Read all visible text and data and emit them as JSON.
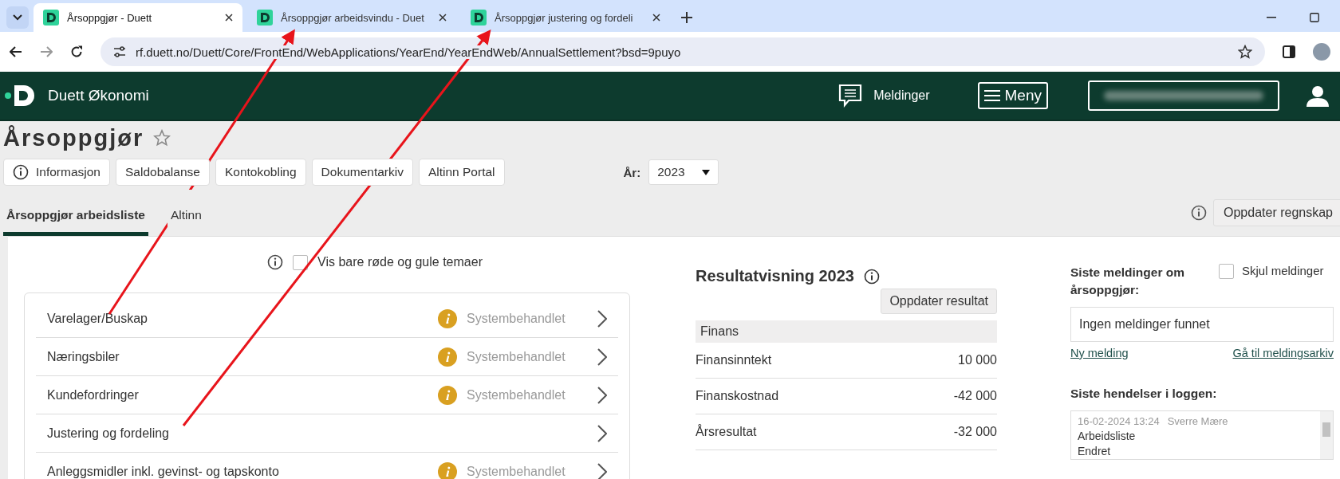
{
  "browser": {
    "tabs": [
      {
        "title": "Årsoppgjør - Duett",
        "selected": true
      },
      {
        "title": "Årsoppgjør arbeidsvindu - Duet",
        "selected": false
      },
      {
        "title": "Årsoppgjør justering og fordeli",
        "selected": false
      }
    ],
    "url": "rf.duett.no/Duett/Core/FrontEnd/WebApplications/YearEnd/YearEndWeb/AnnualSettlement?bsd=9puyo"
  },
  "header": {
    "brand": "Duett Økonomi",
    "messages": "Meldinger",
    "menu": "Meny"
  },
  "page": {
    "title": "Årsoppgjør",
    "toolbar": [
      {
        "label": "Informasjon",
        "kind": "info"
      },
      {
        "label": "Saldobalanse",
        "kind": "plain"
      },
      {
        "label": "Kontokobling",
        "kind": "plain"
      },
      {
        "label": "Dokumentarkiv",
        "kind": "plain"
      },
      {
        "label": "Altinn Portal",
        "kind": "plain"
      }
    ],
    "year_label": "År:",
    "year": "2023",
    "tabs": [
      {
        "label": "Årsoppgjør arbeidsliste",
        "selected": true
      },
      {
        "label": "Altinn",
        "selected": false
      }
    ],
    "refresh_button": "Oppdater regnskap"
  },
  "filter": {
    "label": "Vis bare røde og gule temaer",
    "checked": false
  },
  "worklist": [
    {
      "name": "Varelager/Buskap",
      "status": "Systembehandlet"
    },
    {
      "name": "Næringsbiler",
      "status": "Systembehandlet"
    },
    {
      "name": "Kundefordringer",
      "status": "Systembehandlet"
    },
    {
      "name": "Justering og fordeling"
    },
    {
      "name": "Anleggsmidler inkl. gevinst- og tapskonto",
      "status": "Systembehandlet"
    }
  ],
  "results": {
    "title": "Resultatvisning 2023",
    "update_button": "Oppdater resultat",
    "section": "Finans",
    "rows": [
      {
        "label": "Finansinntekt",
        "value": "10 000"
      },
      {
        "label": "Finanskostnad",
        "value": "-42 000"
      },
      {
        "label": "Årsresultat",
        "value": "-32 000"
      }
    ]
  },
  "messages": {
    "title": "Siste meldinger om årsoppgjør:",
    "hide": {
      "label": "Skjul meldinger",
      "checked": false
    },
    "empty": "Ingen meldinger funnet",
    "new_link": "Ny melding",
    "archive_link": "Gå til meldingsarkiv"
  },
  "log": {
    "title": "Siste hendelser i loggen:",
    "entries": [
      {
        "date": "16-02-2024 13:24",
        "user": "Sverre Mære",
        "lines": [
          "Arbeidsliste",
          "Endret"
        ]
      }
    ]
  }
}
